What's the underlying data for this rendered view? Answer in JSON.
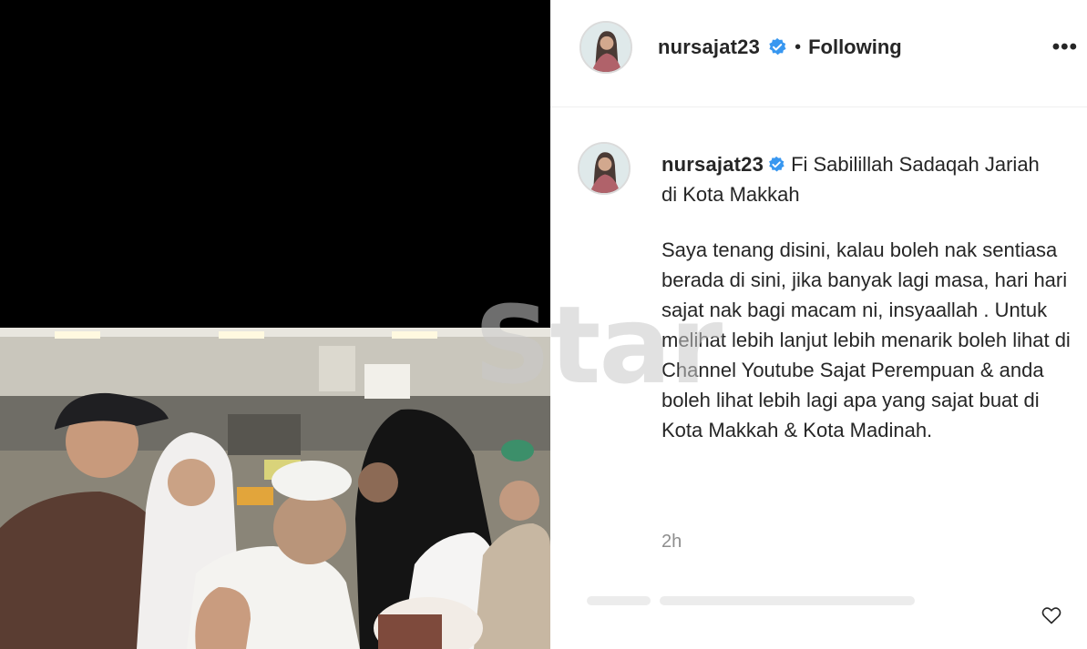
{
  "post": {
    "username": "nursajat23",
    "separator": "•",
    "follow_status": "Following",
    "more_label": "•••",
    "caption_title": "Fi Sabilillah Sadaqah Jariah di Kota Makkah",
    "caption_body": "Saya tenang disini, kalau boleh nak sentiasa berada di sini, jika banyak lagi masa, hari hari sajat nak bagi macam ni, insyaallah . Untuk melihat lebih lanjut lebih menarik boleh lihat di Channel Youtube Sajat Perempuan & anda boleh lihat lebih lagi apa yang sajat buat di Kota Makkah & Kota Madinah.",
    "time": "2h"
  },
  "watermark": {
    "text": "Star"
  },
  "colors": {
    "verified": "#3897f0",
    "text": "#262626",
    "muted": "#8e8e8e",
    "border": "#efefef"
  },
  "icons": {
    "verified": "verified-badge-icon",
    "more": "more-options-icon",
    "like": "heart-icon"
  }
}
